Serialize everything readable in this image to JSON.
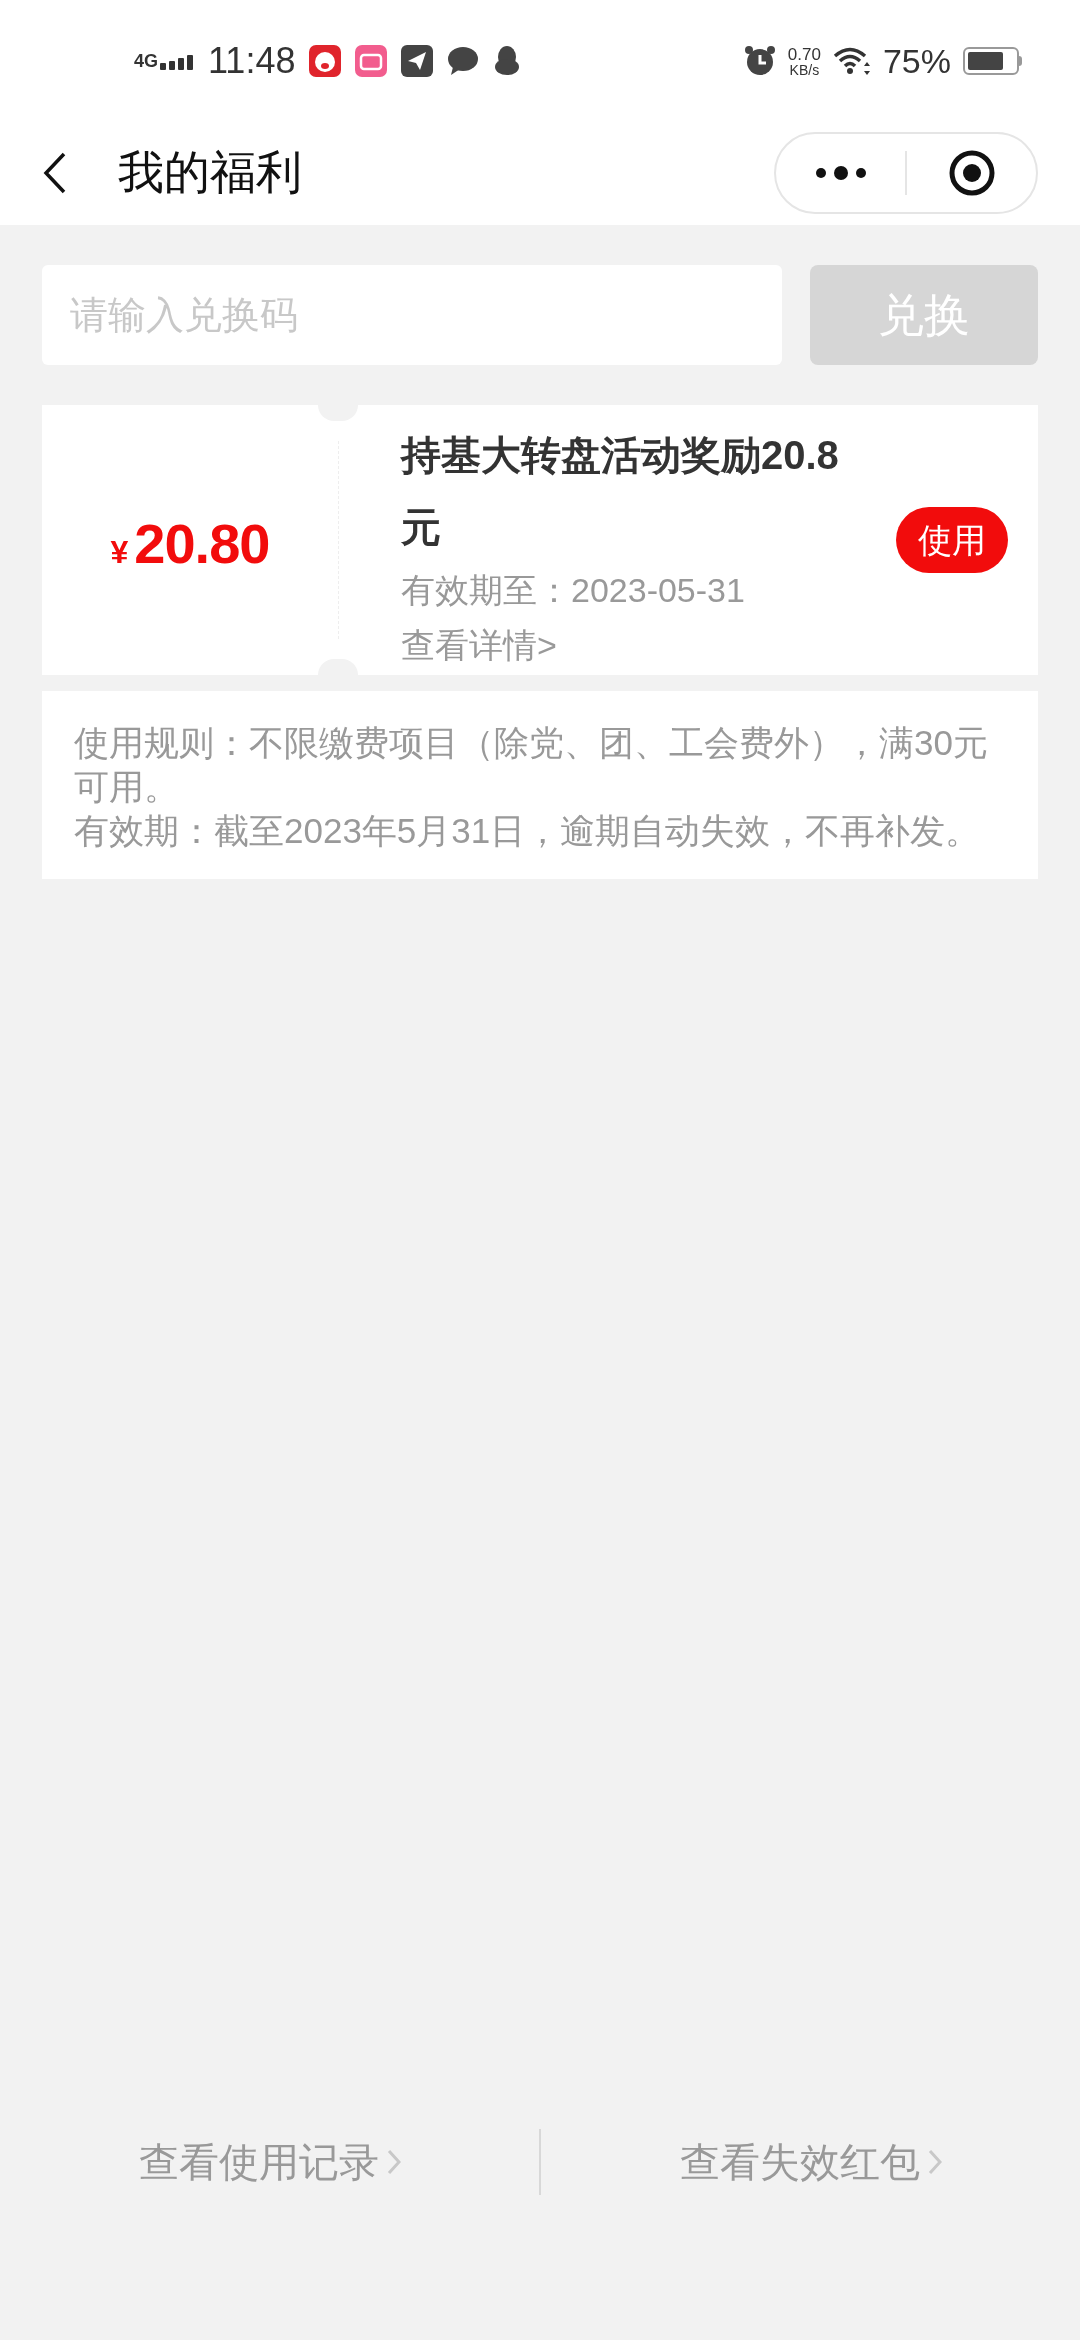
{
  "status_bar": {
    "network": "4G",
    "time": "11:48",
    "speed_value": "0.70",
    "speed_unit": "KB/s",
    "battery": "75%"
  },
  "nav": {
    "title": "我的福利"
  },
  "redeem": {
    "placeholder": "请输入兑换码",
    "button": "兑换",
    "disabled": true
  },
  "coupons": [
    {
      "currency": "¥",
      "amount": "20.80",
      "title": "持基大转盘活动奖励20.8元",
      "expiry": "有效期至：2023-05-31",
      "details": "查看详情>",
      "action": "使用"
    }
  ],
  "rules": [
    "使用规则：不限缴费项目（除党、团、工会费外），满30元可用。",
    "有效期：截至2023年5月31日，逾期自动失效，不再补发。"
  ],
  "footer_links": [
    "查看使用记录",
    "查看失效红包"
  ]
}
